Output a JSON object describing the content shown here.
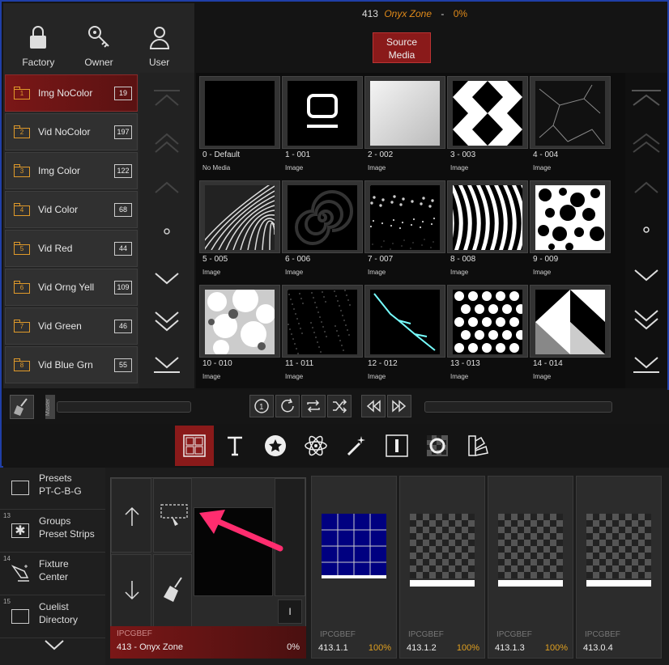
{
  "header": {
    "number": "413",
    "zone": "Onyx Zone",
    "separator": "-",
    "percent": "0%"
  },
  "source_button": {
    "label": "Source Media"
  },
  "tools": [
    {
      "label": "Factory",
      "icon": "lock-icon"
    },
    {
      "label": "Owner",
      "icon": "key-icon"
    },
    {
      "label": "User",
      "icon": "user-icon"
    }
  ],
  "folders": [
    {
      "num": "1",
      "label": "Img NoColor",
      "count": "19",
      "selected": true
    },
    {
      "num": "2",
      "label": "Vid NoColor",
      "count": "197"
    },
    {
      "num": "3",
      "label": "Img Color",
      "count": "122"
    },
    {
      "num": "4",
      "label": "Vid Color",
      "count": "68"
    },
    {
      "num": "5",
      "label": "Vid Red",
      "count": "44"
    },
    {
      "num": "6",
      "label": "Vid Orng Yell",
      "count": "109"
    },
    {
      "num": "7",
      "label": "Vid Green",
      "count": "46"
    },
    {
      "num": "8",
      "label": "Vid Blue Grn",
      "count": "55"
    }
  ],
  "media": [
    {
      "name": "0 - Default",
      "type": "No Media",
      "pattern": "black"
    },
    {
      "name": "1 - 001",
      "type": "Image",
      "pattern": "monitor"
    },
    {
      "name": "2 - 002",
      "type": "Image",
      "pattern": "white"
    },
    {
      "name": "3 - 003",
      "type": "Image",
      "pattern": "diamond"
    },
    {
      "name": "4 - 004",
      "type": "Image",
      "pattern": "cracks"
    },
    {
      "name": "5 - 005",
      "type": "Image",
      "pattern": "feather"
    },
    {
      "name": "6 - 006",
      "type": "Image",
      "pattern": "spiral"
    },
    {
      "name": "7 - 007",
      "type": "Image",
      "pattern": "specks"
    },
    {
      "name": "8 - 008",
      "type": "Image",
      "pattern": "zebra"
    },
    {
      "name": "9 - 009",
      "type": "Image",
      "pattern": "dots"
    },
    {
      "name": "10 - 010",
      "type": "Image",
      "pattern": "clouds"
    },
    {
      "name": "11 - 011",
      "type": "Image",
      "pattern": "stars"
    },
    {
      "name": "12 - 012",
      "type": "Image",
      "pattern": "lightning"
    },
    {
      "name": "13 - 013",
      "type": "Image",
      "pattern": "polka"
    },
    {
      "name": "14 - 014",
      "type": "Image",
      "pattern": "triangles"
    }
  ],
  "master": {
    "label": "Master"
  },
  "nav": [
    {
      "num": "",
      "l1": "Presets",
      "l2": "PT-C-B-G",
      "icon": "square-icon"
    },
    {
      "num": "13",
      "l1": "Groups",
      "l2": "Preset Strips",
      "icon": "asterisk-icon"
    },
    {
      "num": "14",
      "l1": "Fixture",
      "l2": "Center",
      "icon": "lamp-icon"
    },
    {
      "num": "15",
      "l1": "Cuelist",
      "l2": "Directory",
      "icon": "square-icon"
    }
  ],
  "main_fixture": {
    "sub": "IPCGBEF",
    "name": "413 - Onyx Zone",
    "percent": "0%",
    "button": "I"
  },
  "fixtures": [
    {
      "sub": "IPCGBEF",
      "addr": "413.1.1",
      "level": "100%",
      "screen": "grid"
    },
    {
      "sub": "IPCGBEF",
      "addr": "413.1.2",
      "level": "100%",
      "screen": "checker"
    },
    {
      "sub": "IPCGBEF",
      "addr": "413.1.3",
      "level": "100%",
      "screen": "checker"
    },
    {
      "sub": "IPCGBEF",
      "addr": "413.0.4",
      "level": "",
      "screen": "checker"
    }
  ],
  "colors": {
    "accent_red": "#8a1a1a",
    "popup_border": "#1f3fa8",
    "orange": "#e08a1a",
    "arrow": "#ff2d6f"
  }
}
